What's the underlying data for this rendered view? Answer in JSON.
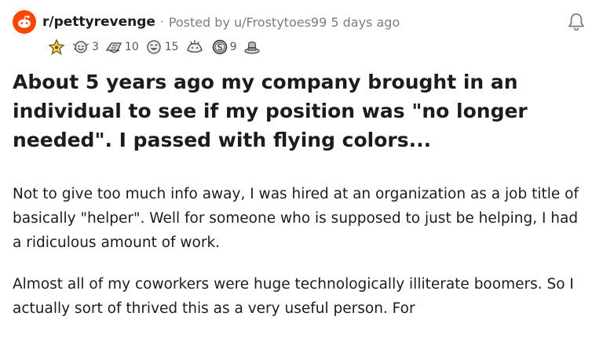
{
  "post": {
    "subreddit": "r/pettyrevenge",
    "separator": "·",
    "posted_by": "Posted by u/Frostytoes99 5 days ago",
    "awards": [
      {
        "icon": "gold-star-award-icon",
        "count": ""
      },
      {
        "icon": "wholesome-award-icon",
        "count": "3"
      },
      {
        "icon": "helpful-award-icon",
        "count": "10"
      },
      {
        "icon": "laughing-award-icon",
        "count": "15"
      },
      {
        "icon": "bravo-award-icon",
        "count": ""
      },
      {
        "icon": "silver-coin-award-icon",
        "count": "9"
      },
      {
        "icon": "hat-award-icon",
        "count": ""
      }
    ],
    "title": "About 5 years ago my company brought in an individual to see if my position was \"no longer needed\". I passed with flying colors...",
    "paragraphs": [
      "Not to give too much info away, I was hired at an organization as a job title of basically \"helper\". Well for someone who is supposed to just be helping, I had a ridiculous amount of work.",
      "Almost all of my coworkers were huge technologically illiterate boomers. So I actually sort of thrived this as a very useful person. For"
    ]
  },
  "colors": {
    "brand": "#ff4500",
    "text": "#1c1c1c",
    "meta": "#7c7c7c"
  }
}
